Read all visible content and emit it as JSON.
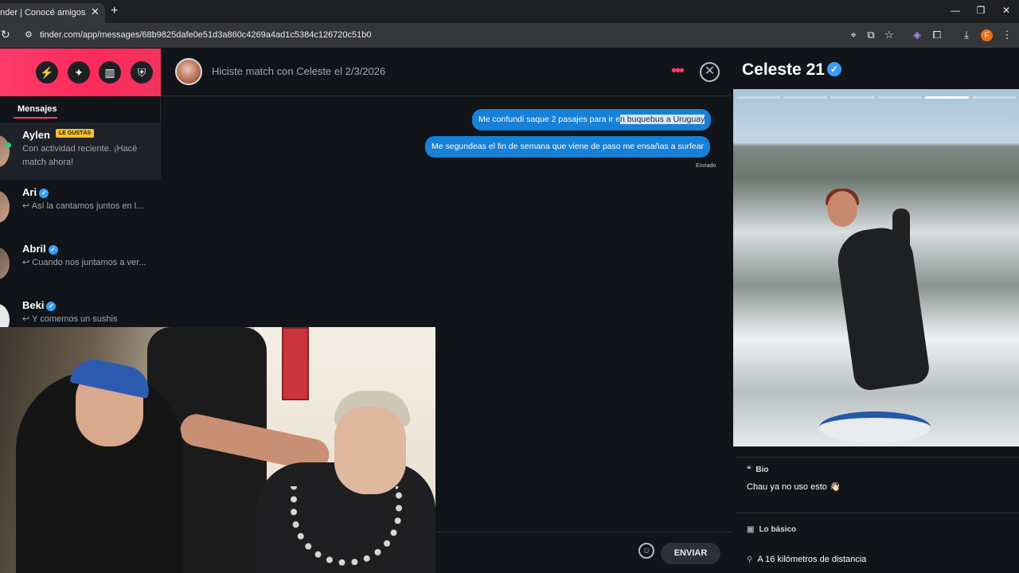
{
  "browser": {
    "tab_title": "nder | Conocé amigos y gente",
    "tab_close": "✕",
    "new_tab": "+",
    "url": "tinder.com/app/messages/68b9825dafe0e51d3a860c4269a4ad1c5384c126720c51b0",
    "profile_initial": "F",
    "window_controls": [
      "—",
      "❐",
      "✕"
    ]
  },
  "sidebar": {
    "header_icons": [
      "bolt-icon",
      "compass-icon",
      "stack-icon",
      "shield-icon"
    ],
    "tab_label": "Mensajes",
    "conversations": [
      {
        "name": "Aylen",
        "badge": "LE GUSTÁS",
        "preview": "Con actividad reciente. ¡Hacé match ahora!",
        "online": true
      },
      {
        "name": "Ari",
        "verified": true,
        "preview": "↩ Así la cantamos juntos en l..."
      },
      {
        "name": "Abril",
        "verified": true,
        "preview": "↩ Cuando nos juntamos a ver..."
      },
      {
        "name": "Beki",
        "verified": true,
        "preview": "↩ Y comemos un sushis"
      }
    ]
  },
  "chat": {
    "match_text": "Hiciste match con Celeste el 2/3/2026",
    "messages": [
      {
        "before_highlight": "Me confundi saque 2 pasajes para ir e",
        "highlight": "n buquebus a Uruguay"
      },
      {
        "text": "Me segundeas el fin de semana que viene de paso me ensañas a surfear"
      }
    ],
    "sent_label": "Enviado",
    "send_button": "ENVIAR"
  },
  "profile": {
    "name": "Celeste",
    "age": "21",
    "photo_count": 6,
    "active_photo": 5,
    "bio_label": "Bio",
    "bio_text": "Chau ya no uso esto 👋🏻",
    "basics_label": "Lo básico",
    "distance": "A 16 kilómetros de distancia"
  },
  "colors": {
    "brand_gradient_start": "#fd3b6a",
    "message_bubble": "#1780d7",
    "verified": "#3b9cf5",
    "badge": "#f6c22a",
    "online": "#27d17f"
  }
}
